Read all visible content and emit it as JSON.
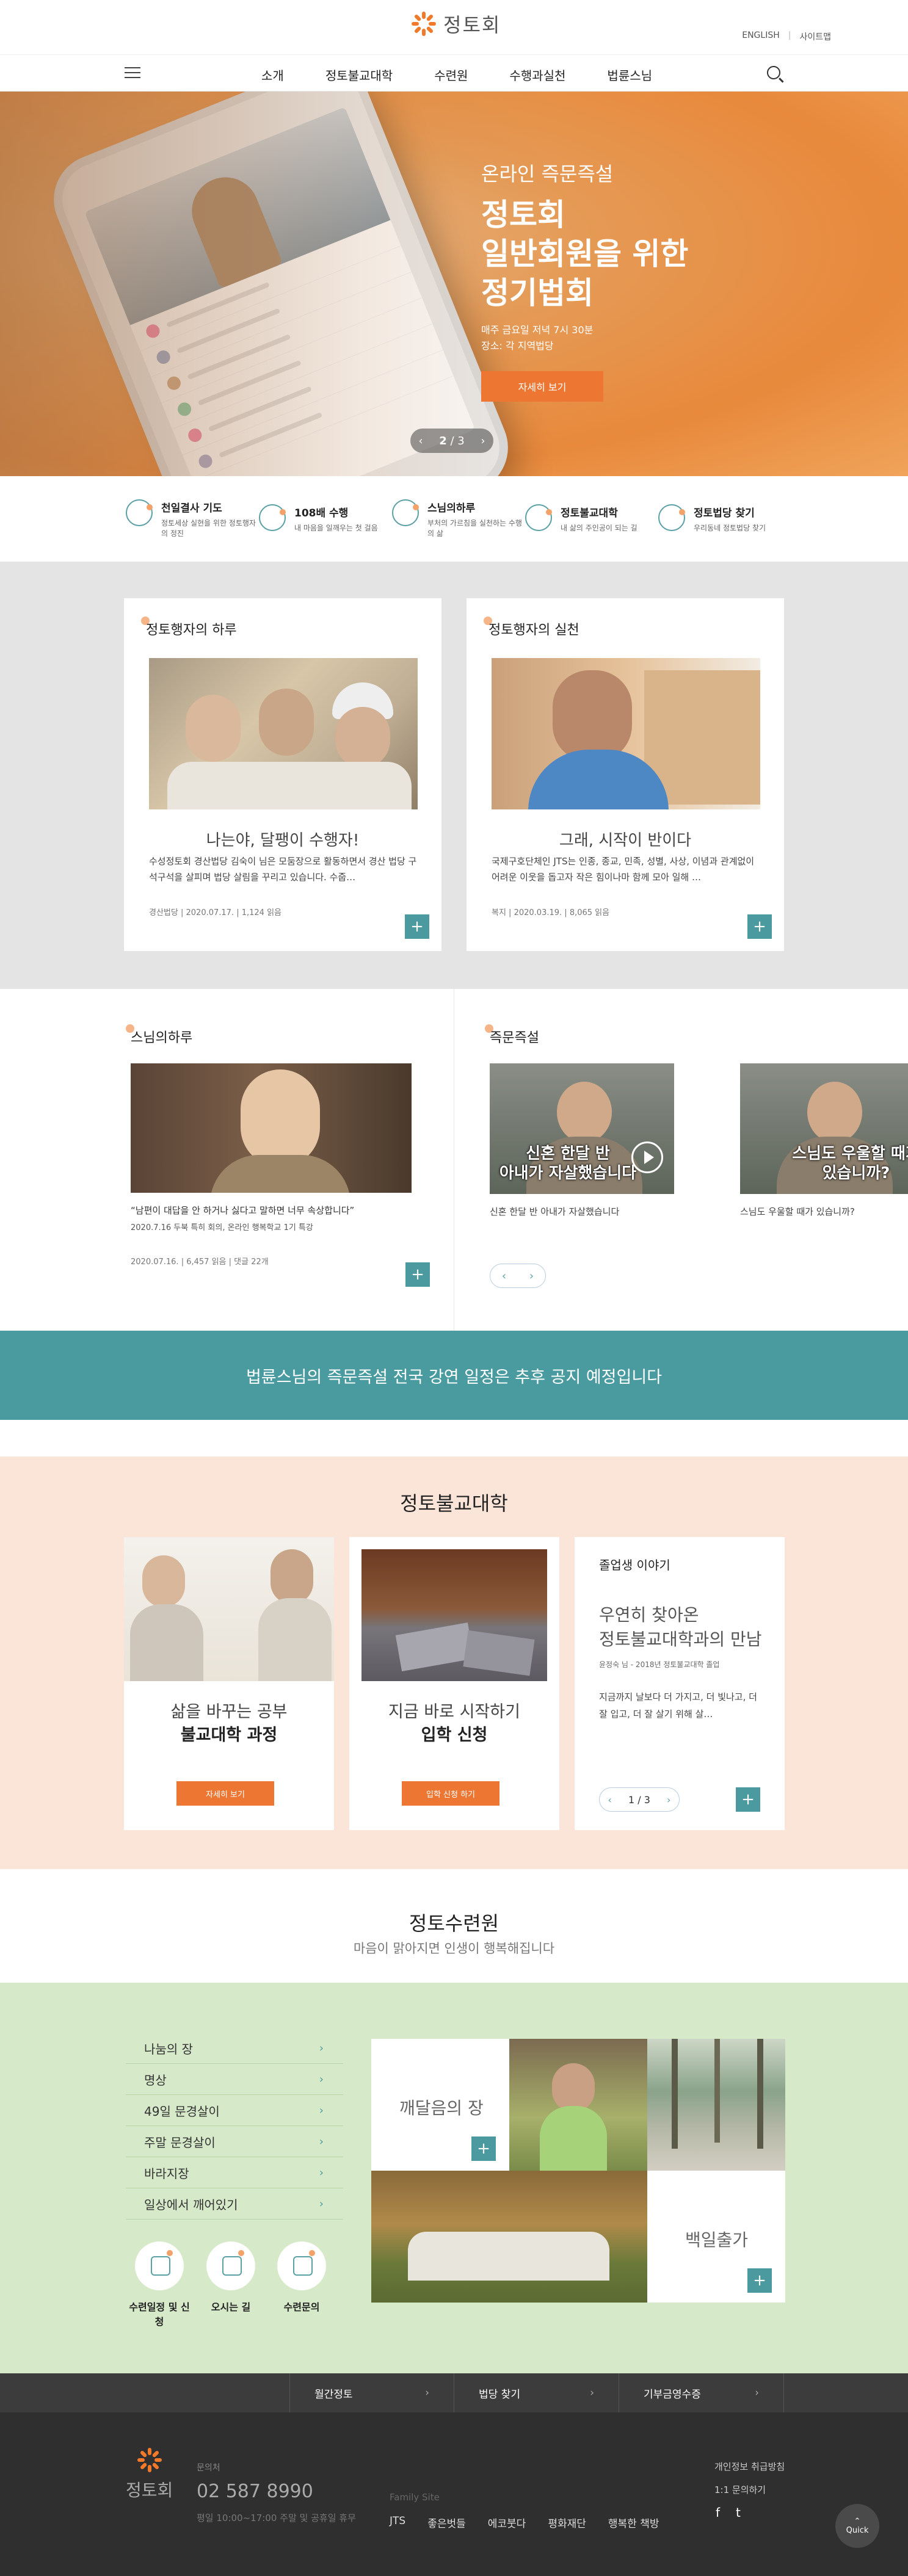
{
  "header": {
    "logo_text": "정토회",
    "util": [
      "ENGLISH",
      "사이트맵"
    ],
    "nav": [
      "소개",
      "정토불교대학",
      "수련원",
      "수행과실천",
      "법륜스님"
    ]
  },
  "hero": {
    "subtitle": "온라인 즉문즉설",
    "title_lines": [
      "정토회",
      "일반회원을 위한",
      "정기법회"
    ],
    "info_lines": [
      "매주 금요일 저녁 7시 30분",
      "장소: 각 지역법당"
    ],
    "button": "자세히 보기",
    "pager_current": "2",
    "pager_total": "3"
  },
  "quick_links": [
    {
      "title": "천일결사 기도",
      "desc": "정토세상 실현을 위한 정토행자의 정진"
    },
    {
      "title": "108배 수행",
      "desc": "내 마음을 일깨우는 첫 걸음"
    },
    {
      "title": "스님의하루",
      "desc": "부처의 가르침을 실천하는 수행의 삶"
    },
    {
      "title": "정토불교대학",
      "desc": "내 삶의 주인공이 되는 길"
    },
    {
      "title": "정토법당 찾기",
      "desc": "우리동네 정토법당 찾기"
    }
  ],
  "practice_day": {
    "title": "정토행자의 하루",
    "headline": "나는야, 달팽이 수행자!",
    "desc": "수성정토회 경산법당 김숙이 님은 모둠장으로 활동하면서 경산 법당 구석구석을 살피며 법당 살림을 꾸리고 있습니다. 수줍…",
    "meta": [
      "경산법당",
      "2020.07.17.",
      "1,124 읽음"
    ]
  },
  "practice_action": {
    "title": "정토행자의 실천",
    "headline": "그래, 시작이 반이다",
    "desc": "국제구호단체인 JTS는 인종, 종교, 민족, 성별, 사상, 이념과 관계없이 어려운 이웃을 돕고자 작은 힘이나마 함께 모아 일해 …",
    "meta": [
      "복지",
      "2020.03.19.",
      "8,065 읽음"
    ]
  },
  "monk_day": {
    "title": "스님의하루",
    "quote": "“남편이 대답을 안 하거나 싫다고 말하면 너무 속상합니다”",
    "sub": "2020.7.16 두북 특히 회의, 온라인 행복학교 1기 특강",
    "meta": [
      "2020.07.16.",
      "6,457 읽음",
      "댓글 22개"
    ]
  },
  "qna": {
    "title": "즉문즉설",
    "videos": [
      {
        "caption_lines": [
          "신혼 한달 반",
          "아내가 자살했습니다"
        ],
        "title": "신혼 한달 반 아내가 자살했습니다"
      },
      {
        "caption_lines": [
          "스님도 우울할 때가",
          "있습니까?"
        ],
        "title": "스님도 우울할 때가 있습니까?"
      }
    ]
  },
  "banner": {
    "text": "법륜스님의 즉문즉설 전국 강연 일정은 추후 공지 예정입니다"
  },
  "university": {
    "title": "정토불교대학",
    "cards": [
      {
        "line1": "삶을 바꾸는 공부",
        "line2": "불교대학 과정",
        "button": "자세히 보기"
      },
      {
        "line1": "지금 바로 시작하기",
        "line2": "입학 신청",
        "button": "입학 신청 하기"
      }
    ],
    "graduate": {
      "title": "졸업생 이야기",
      "head_lines": [
        "우연히 찾아온",
        "정토불교대학과의 만남"
      ],
      "meta": "윤정숙 님 - 2018년 정토불교대학 졸업",
      "desc": "지금까지 날보다 더 가지고, 더 빛나고, 더 잘 입고, 더 잘 살기 위해 살…",
      "pager_current": "1",
      "pager_total": "3"
    }
  },
  "training": {
    "title": "정토수련원",
    "subtitle": "마음이 맑아지면 인생이 행복해집니다",
    "menu": [
      "나눔의 장",
      "명상",
      "49일 문경살이",
      "주말 문경살이",
      "바라지장",
      "일상에서 깨어있기"
    ],
    "circles": [
      "수련일정 및 신청",
      "오시는 길",
      "수련문의"
    ],
    "tiles": [
      "깨달음의 장",
      "백일출가"
    ]
  },
  "dark_nav": [
    "월간정토",
    "법당 찾기",
    "기부금영수증"
  ],
  "footer": {
    "logo_text": "정토회",
    "contact_label": "문의처",
    "phone": "02 587 8990",
    "hours": "평일 10:00~17:00 주말 및 공휴일 휴무",
    "family_label": "Family Site",
    "family_links": [
      "JTS",
      "좋은벗들",
      "에코붓다",
      "평화재단",
      "행복한 책방"
    ],
    "right_links": [
      "개인정보 취급방침",
      "1:1 문의하기"
    ],
    "social": [
      "f",
      "t"
    ],
    "quick": "Quick"
  },
  "colors": {
    "accent_orange": "#ed7732",
    "teal": "#4a9ba0",
    "peach_bg": "#fbe4d8",
    "green_bg": "#d6e9c9",
    "gray_bg": "#e4e4e4"
  }
}
